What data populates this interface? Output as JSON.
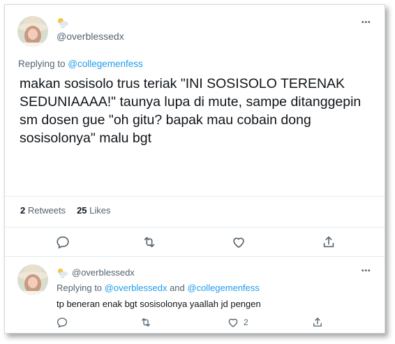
{
  "main_tweet": {
    "handle": "@overblessedx",
    "replying_prefix": "Replying to ",
    "replying_to": "@collegemenfess",
    "text": "makan sosisolo trus teriak \"INI SOSISOLO TERENAK SEDUNIAAAA!\" taunya lupa di mute, sampe ditanggepin sm dosen gue \"oh gitu? bapak mau cobain dong sosisolonya\" malu bgt",
    "retweets_count": "2",
    "retweets_label": "Retweets",
    "likes_count": "25",
    "likes_label": "Likes",
    "more": "•••"
  },
  "reply_tweet": {
    "handle": "@overblessedx",
    "replying_prefix": "Replying to ",
    "replying_to_1": "@overblessedx",
    "and_word": " and ",
    "replying_to_2": "@collegemenfess",
    "text": "tp beneran enak bgt sosisolonya yaallah jd pengen",
    "like_count": "2",
    "more": "•••"
  },
  "colors": {
    "link": "#1d9bf0",
    "secondary_text": "#536471",
    "primary_text": "#0f1419"
  },
  "icons": [
    "cloud-sun-icon",
    "more-icon",
    "reply-icon",
    "retweet-icon",
    "like-icon",
    "share-icon"
  ]
}
